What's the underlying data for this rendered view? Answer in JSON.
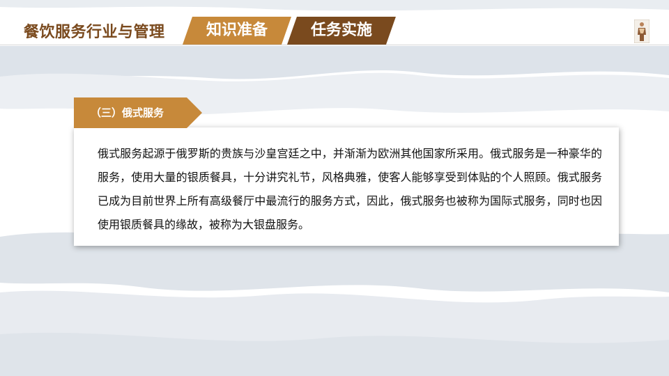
{
  "header": {
    "course_title": "餐饮服务行业与管理",
    "tabs": [
      {
        "label": "知识准备"
      },
      {
        "label": "任务实施"
      }
    ]
  },
  "section": {
    "title": "（三）俄式服务",
    "paragraph": "俄式服务起源于俄罗斯的贵族与沙皇宫廷之中，并渐渐为欧洲其他国家所采用。俄式服务是一种豪华的服务，使用大量的银质餐具，十分讲究礼节，风格典雅，使客人能够享受到体贴的个人照顾。俄式服务已成为目前世界上所有高级餐厅中最流行的服务方式，因此，俄式服务也被称为国际式服务，同时也因使用银质餐具的缘故，被称为大银盘服务。"
  },
  "colors": {
    "accent_gold": "#c7893a",
    "accent_brown": "#7a4a1e"
  },
  "icons": {
    "logo": "figure-logo-icon"
  }
}
